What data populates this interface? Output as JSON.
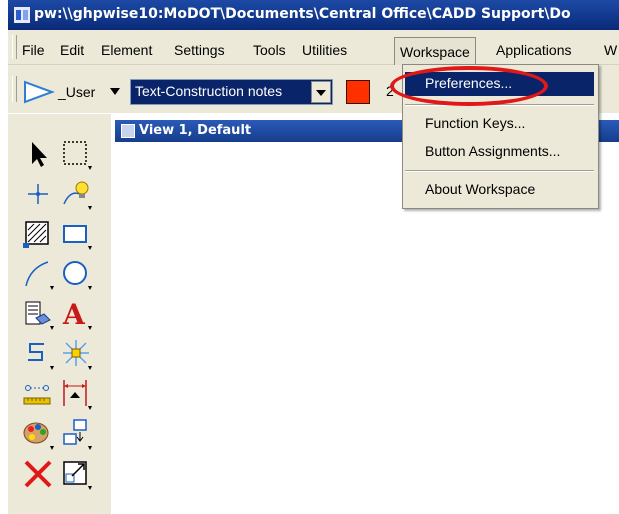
{
  "window": {
    "title": "pw:\\\\ghpwise10:MoDOT\\Documents\\Central Office\\CADD Support\\Do"
  },
  "menubar": {
    "items": [
      "File",
      "Edit",
      "Element",
      "Settings",
      "Tools",
      "Utilities",
      "Workspace",
      "Applications",
      "W"
    ]
  },
  "toolbar": {
    "user_label": "_User",
    "text_style": "Text-Construction notes",
    "active_color": "#ff3000",
    "level_left": "2",
    "level_right": "2"
  },
  "workspace_menu": {
    "items": [
      {
        "label": "Preferences...",
        "highlighted": true
      },
      {
        "label": "Function Keys..."
      },
      {
        "label": "Button Assignments..."
      },
      {
        "label": "About Workspace"
      }
    ]
  },
  "view": {
    "title": "View 1, Default"
  },
  "palette": {
    "tools": [
      "select-arrow-icon",
      "fence-icon",
      "tentative-point-icon",
      "light-bulb-icon",
      "hatch-icon",
      "rectangle-icon",
      "arc-icon",
      "circle-icon",
      "cell-icon",
      "text-A-icon",
      "line-string-icon",
      "explosion-icon",
      "measure-icon",
      "dimension-icon",
      "palette-icon",
      "move-copy-icon",
      "delete-x-icon",
      "scale-icon"
    ]
  },
  "annotation": {
    "highlight_color": "#e01818"
  }
}
